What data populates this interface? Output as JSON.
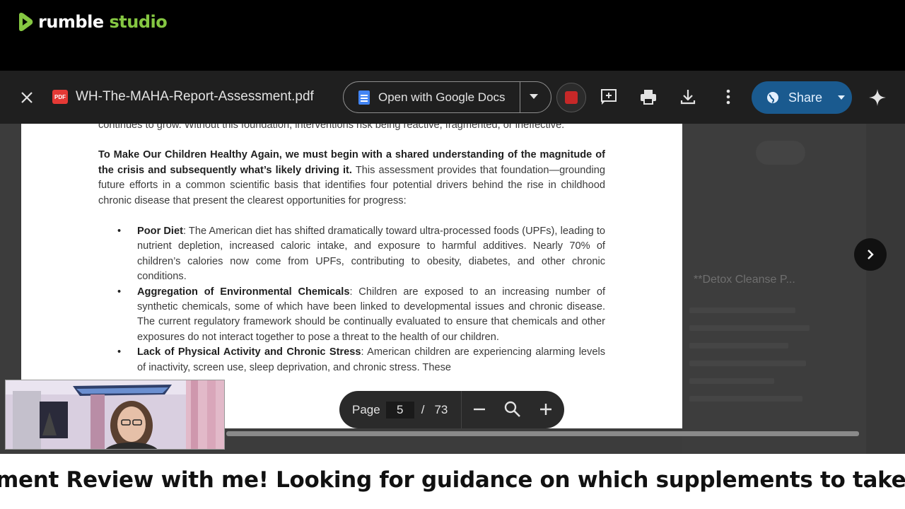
{
  "brand": {
    "name_part1": "rumble",
    "name_part2": "studio",
    "accent": "#85c742"
  },
  "viewer": {
    "filename": "WH-The-MAHA-Report-Assessment.pdf",
    "file_type_badge": "PDF",
    "open_with_label": "Open with Google Docs",
    "share_label": "Share",
    "icons": [
      "close-icon",
      "google-docs-icon",
      "acrobat-icon",
      "add-comment-icon",
      "print-icon",
      "download-icon",
      "more-vert-icon",
      "globe-icon",
      "gemini-sparkle-icon",
      "chevron-right-icon"
    ]
  },
  "document": {
    "intro_text": "continues to grow. Without this foundation, interventions risk being reactive, fragmented, or ineffective.",
    "para_bold": "To Make Our Children Healthy Again, we must begin with a shared understanding of the magnitude of the crisis and subsequently what’s likely driving it.",
    "para_rest": " This assessment provides that foundation—grounding future efforts in a common scientific basis that identifies four potential drivers behind the rise in childhood chronic disease that present the clearest opportunities for progress:",
    "bullets": [
      {
        "title": "Poor Diet",
        "text": ": The American diet has shifted dramatically toward ultra-processed foods (UPFs), leading to nutrient depletion, increased caloric intake, and exposure to harmful additives. Nearly 70% of children’s calories now come from UPFs, contributing to obesity, diabetes, and other chronic conditions."
      },
      {
        "title": "Aggregation of Environmental Chemicals",
        "text": ": Children are exposed to an increasing number of synthetic chemicals, some of which have been linked to developmental issues and chronic disease. The current regulatory framework should be continually evaluated to ensure that chemicals and other exposures do not interact together to pose a threat to the health of our children."
      },
      {
        "title": "Lack of Physical Activity and Chronic Stress",
        "text": ": American children are experiencing alarming levels of inactivity, screen use, sleep deprivation, and chronic stress. These"
      }
    ]
  },
  "pager": {
    "label": "Page",
    "current": "5",
    "separator": "/",
    "total": "73"
  },
  "background_app": {
    "snippet": "**Detox Cleanse P..."
  },
  "ticker": {
    "text": "ment Review with me! Looking for guidance on which supplements to take? Schedu"
  }
}
